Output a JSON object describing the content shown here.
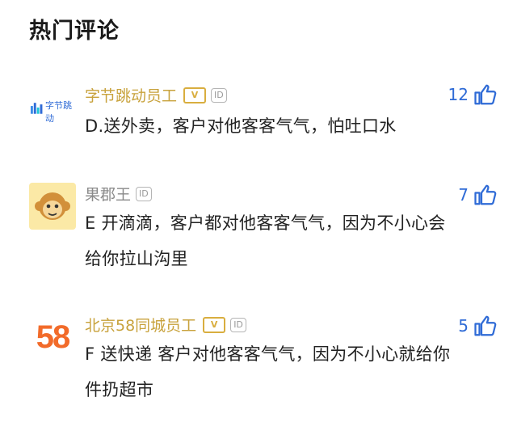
{
  "section": {
    "title": "热门评论"
  },
  "comments": [
    {
      "avatar_text": "字节跳动",
      "username": "字节跳动员工",
      "badge_v": "V",
      "badge_id": "ID",
      "text": "D.送外卖，客户对他客客气气，怕吐口水",
      "likes": "12"
    },
    {
      "avatar_text": "",
      "username": "果郡王",
      "badge_id": "ID",
      "text": "E 开滴滴，客户都对他客客气气，因为不小心会给你拉山沟里",
      "likes": "7"
    },
    {
      "avatar_text": "58",
      "username": "北京58同城员工",
      "badge_v": "V",
      "badge_id": "ID",
      "text": "F 送快递 客户对他客客气气，因为不小心就给你件扔超市",
      "likes": "5"
    }
  ],
  "colors": {
    "accent": "#2f6bd6",
    "verified_name": "#c8a23c",
    "badge": "#d9ae3f"
  }
}
